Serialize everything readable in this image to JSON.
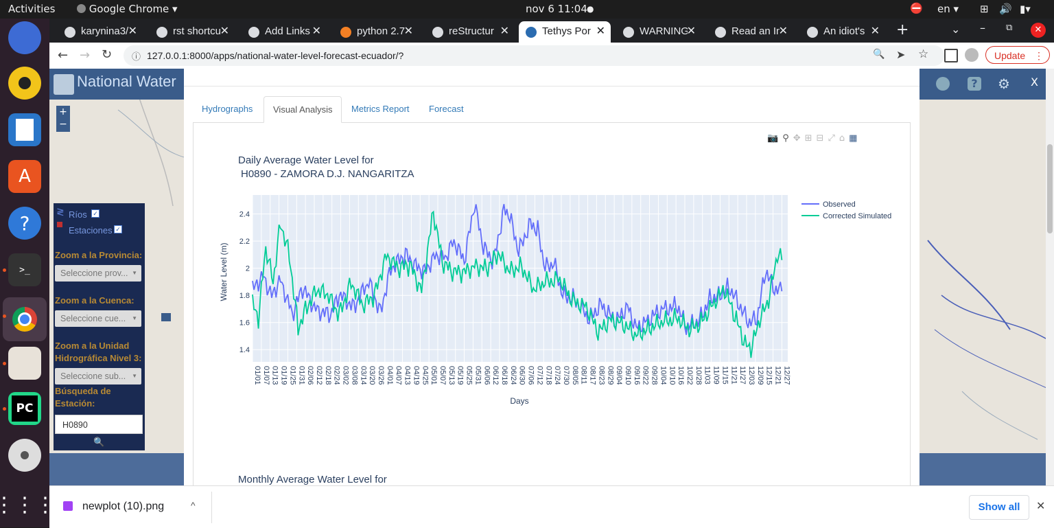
{
  "topbar": {
    "activities": "Activities",
    "app": "Google Chrome",
    "clock": "nov 6  11:04",
    "lang": "en"
  },
  "tabs": [
    {
      "title": "karynina3/"
    },
    {
      "title": "rst shortcu"
    },
    {
      "title": "Add Links"
    },
    {
      "title": "python 2.7"
    },
    {
      "title": "reStructur"
    },
    {
      "title": "Tethys Por"
    },
    {
      "title": "WARNING:"
    },
    {
      "title": "Read an In"
    },
    {
      "title": "An idiot's"
    }
  ],
  "address": {
    "url": "127.0.0.1:8000/apps/national-water-level-forecast-ecuador/?",
    "update_label": "Update"
  },
  "app": {
    "title": "National Water"
  },
  "sidebar": {
    "rios": "Ríos",
    "estaciones": "Estaciones",
    "zoom_provincia": "Zoom a la Provincia:",
    "provincia_select": "Seleccione prov...",
    "zoom_cuenca": "Zoom a la Cuenca:",
    "cuenca_select": "Seleccione cue...",
    "zoom_unidad": "Zoom a la Unidad Hidrográfica Nivel 3:",
    "unidad_select": "Seleccione sub...",
    "busqueda": "Búsqueda de Estación:",
    "station_value": "H0890"
  },
  "modal_tabs": [
    {
      "label": "Hydrographs"
    },
    {
      "label": "Visual Analysis"
    },
    {
      "label": "Metrics Report"
    },
    {
      "label": "Forecast"
    }
  ],
  "chart_data": {
    "type": "line",
    "title": "Daily Average Water Level for",
    "subtitle": "H0890 - ZAMORA D.J. NANGARITZA",
    "xlabel": "Days",
    "ylabel": "Water Level (m)",
    "ylim": [
      1.31,
      2.54
    ],
    "yticks": [
      "1.4",
      "1.6",
      "1.8",
      "2",
      "2.2",
      "2.4"
    ],
    "xticks": [
      "01/01",
      "01/07",
      "01/13",
      "01/19",
      "01/25",
      "01/31",
      "02/06",
      "02/12",
      "02/18",
      "02/24",
      "03/02",
      "03/08",
      "03/14",
      "03/20",
      "03/26",
      "04/01",
      "04/07",
      "04/13",
      "04/19",
      "04/25",
      "05/01",
      "05/07",
      "05/13",
      "05/19",
      "05/25",
      "05/31",
      "06/06",
      "06/12",
      "06/18",
      "06/24",
      "06/30",
      "07/06",
      "07/12",
      "07/18",
      "07/24",
      "07/30",
      "08/05",
      "08/11",
      "08/17",
      "08/23",
      "08/29",
      "09/04",
      "09/10",
      "09/16",
      "09/22",
      "09/28",
      "10/04",
      "10/10",
      "10/16",
      "10/22",
      "10/28",
      "11/03",
      "11/09",
      "11/15",
      "11/21",
      "11/27",
      "12/03",
      "12/09",
      "12/15",
      "12/21",
      "12/27"
    ],
    "legend_position": "right",
    "series": [
      {
        "name": "Observed",
        "color": "#636efa",
        "key_points": [
          [
            1,
            1.84
          ],
          [
            8,
            1.95
          ],
          [
            14,
            1.8
          ],
          [
            20,
            1.92
          ],
          [
            28,
            1.66
          ],
          [
            35,
            1.85
          ],
          [
            44,
            1.7
          ],
          [
            54,
            1.65
          ],
          [
            60,
            1.8
          ],
          [
            70,
            1.72
          ],
          [
            80,
            1.9
          ],
          [
            88,
            1.68
          ],
          [
            95,
            2.0
          ],
          [
            105,
            2.1
          ],
          [
            112,
            2.02
          ],
          [
            118,
            1.98
          ],
          [
            126,
            2.1
          ],
          [
            132,
            2.08
          ],
          [
            138,
            2.2
          ],
          [
            145,
            2.05
          ],
          [
            152,
            2.47
          ],
          [
            158,
            2.15
          ],
          [
            165,
            2.05
          ],
          [
            172,
            2.44
          ],
          [
            176,
            2.38
          ],
          [
            182,
            2.12
          ],
          [
            190,
            2.34
          ],
          [
            195,
            2.28
          ],
          [
            200,
            2.0
          ],
          [
            206,
            2.04
          ],
          [
            212,
            1.8
          ],
          [
            220,
            1.78
          ],
          [
            230,
            1.62
          ],
          [
            238,
            1.74
          ],
          [
            248,
            1.6
          ],
          [
            256,
            1.72
          ],
          [
            262,
            1.56
          ],
          [
            270,
            1.62
          ],
          [
            280,
            1.7
          ],
          [
            290,
            1.72
          ],
          [
            296,
            1.56
          ],
          [
            305,
            1.62
          ],
          [
            312,
            1.78
          ],
          [
            318,
            1.8
          ],
          [
            325,
            1.86
          ],
          [
            330,
            1.78
          ],
          [
            338,
            1.6
          ],
          [
            344,
            1.62
          ],
          [
            350,
            1.98
          ],
          [
            356,
            1.84
          ],
          [
            361,
            1.83
          ]
        ]
      },
      {
        "name": "Corrected Simulated",
        "color": "#00cc96",
        "key_points": [
          [
            1,
            1.74
          ],
          [
            5,
            1.62
          ],
          [
            10,
            2.15
          ],
          [
            15,
            1.9
          ],
          [
            20,
            2.34
          ],
          [
            26,
            2.1
          ],
          [
            32,
            1.56
          ],
          [
            38,
            1.72
          ],
          [
            45,
            1.84
          ],
          [
            52,
            1.8
          ],
          [
            60,
            1.66
          ],
          [
            68,
            1.9
          ],
          [
            76,
            1.72
          ],
          [
            84,
            1.8
          ],
          [
            92,
            2.1
          ],
          [
            100,
            2.0
          ],
          [
            108,
            2.02
          ],
          [
            116,
            1.84
          ],
          [
            124,
            2.42
          ],
          [
            130,
            2.05
          ],
          [
            136,
            1.98
          ],
          [
            144,
            1.96
          ],
          [
            152,
            2.02
          ],
          [
            160,
            2.0
          ],
          [
            168,
            2.1
          ],
          [
            176,
            1.98
          ],
          [
            184,
            2.02
          ],
          [
            192,
            1.84
          ],
          [
            200,
            1.9
          ],
          [
            210,
            1.92
          ],
          [
            218,
            1.76
          ],
          [
            228,
            1.72
          ],
          [
            236,
            1.52
          ],
          [
            244,
            1.62
          ],
          [
            252,
            1.6
          ],
          [
            262,
            1.5
          ],
          [
            270,
            1.56
          ],
          [
            280,
            1.6
          ],
          [
            290,
            1.64
          ],
          [
            298,
            1.54
          ],
          [
            306,
            1.6
          ],
          [
            314,
            1.74
          ],
          [
            322,
            1.84
          ],
          [
            330,
            1.62
          ],
          [
            336,
            1.44
          ],
          [
            340,
            1.4
          ],
          [
            346,
            1.62
          ],
          [
            352,
            1.76
          ],
          [
            358,
            2.1
          ],
          [
            361,
            2.06
          ]
        ]
      }
    ]
  },
  "next_chart": {
    "title": "Monthly Average Water Level for"
  },
  "download": {
    "filename": "newplot (10).png",
    "show_all": "Show all"
  }
}
